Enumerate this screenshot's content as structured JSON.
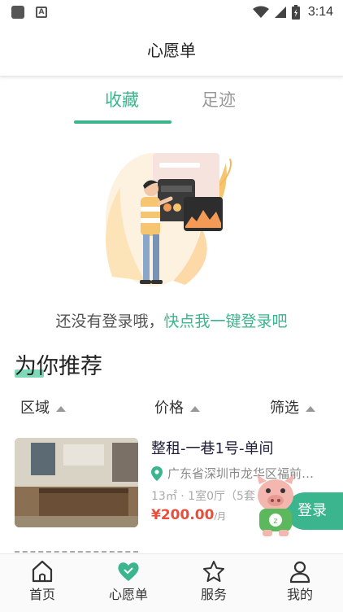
{
  "status_bar": {
    "time": "3:14"
  },
  "header": {
    "title": "心愿单"
  },
  "tabs": [
    {
      "label": "收藏",
      "active": true
    },
    {
      "label": "足迹",
      "active": false
    }
  ],
  "empty_state": {
    "prompt_text": "还没有登录哦，",
    "login_link": "快点我一键登录吧"
  },
  "recommend": {
    "title": "为你推荐",
    "filters": [
      {
        "label": "区域"
      },
      {
        "label": "价格"
      },
      {
        "label": "筛选"
      }
    ]
  },
  "listing": {
    "title": "整租-一巷1号-单间",
    "address": "广东省深圳市龙华区福前…",
    "spec": "13㎡ · 1室0厅（5套",
    "price": "¥200.00",
    "price_unit": "/月"
  },
  "floating_login": {
    "label": "登录"
  },
  "tabbar": [
    {
      "label": "首页",
      "icon": "home-icon"
    },
    {
      "label": "心愿单",
      "icon": "heart-icon"
    },
    {
      "label": "服务",
      "icon": "star-icon"
    },
    {
      "label": "我的",
      "icon": "user-icon"
    }
  ],
  "colors": {
    "accent": "#3bb58d",
    "price": "#e94e3c"
  }
}
